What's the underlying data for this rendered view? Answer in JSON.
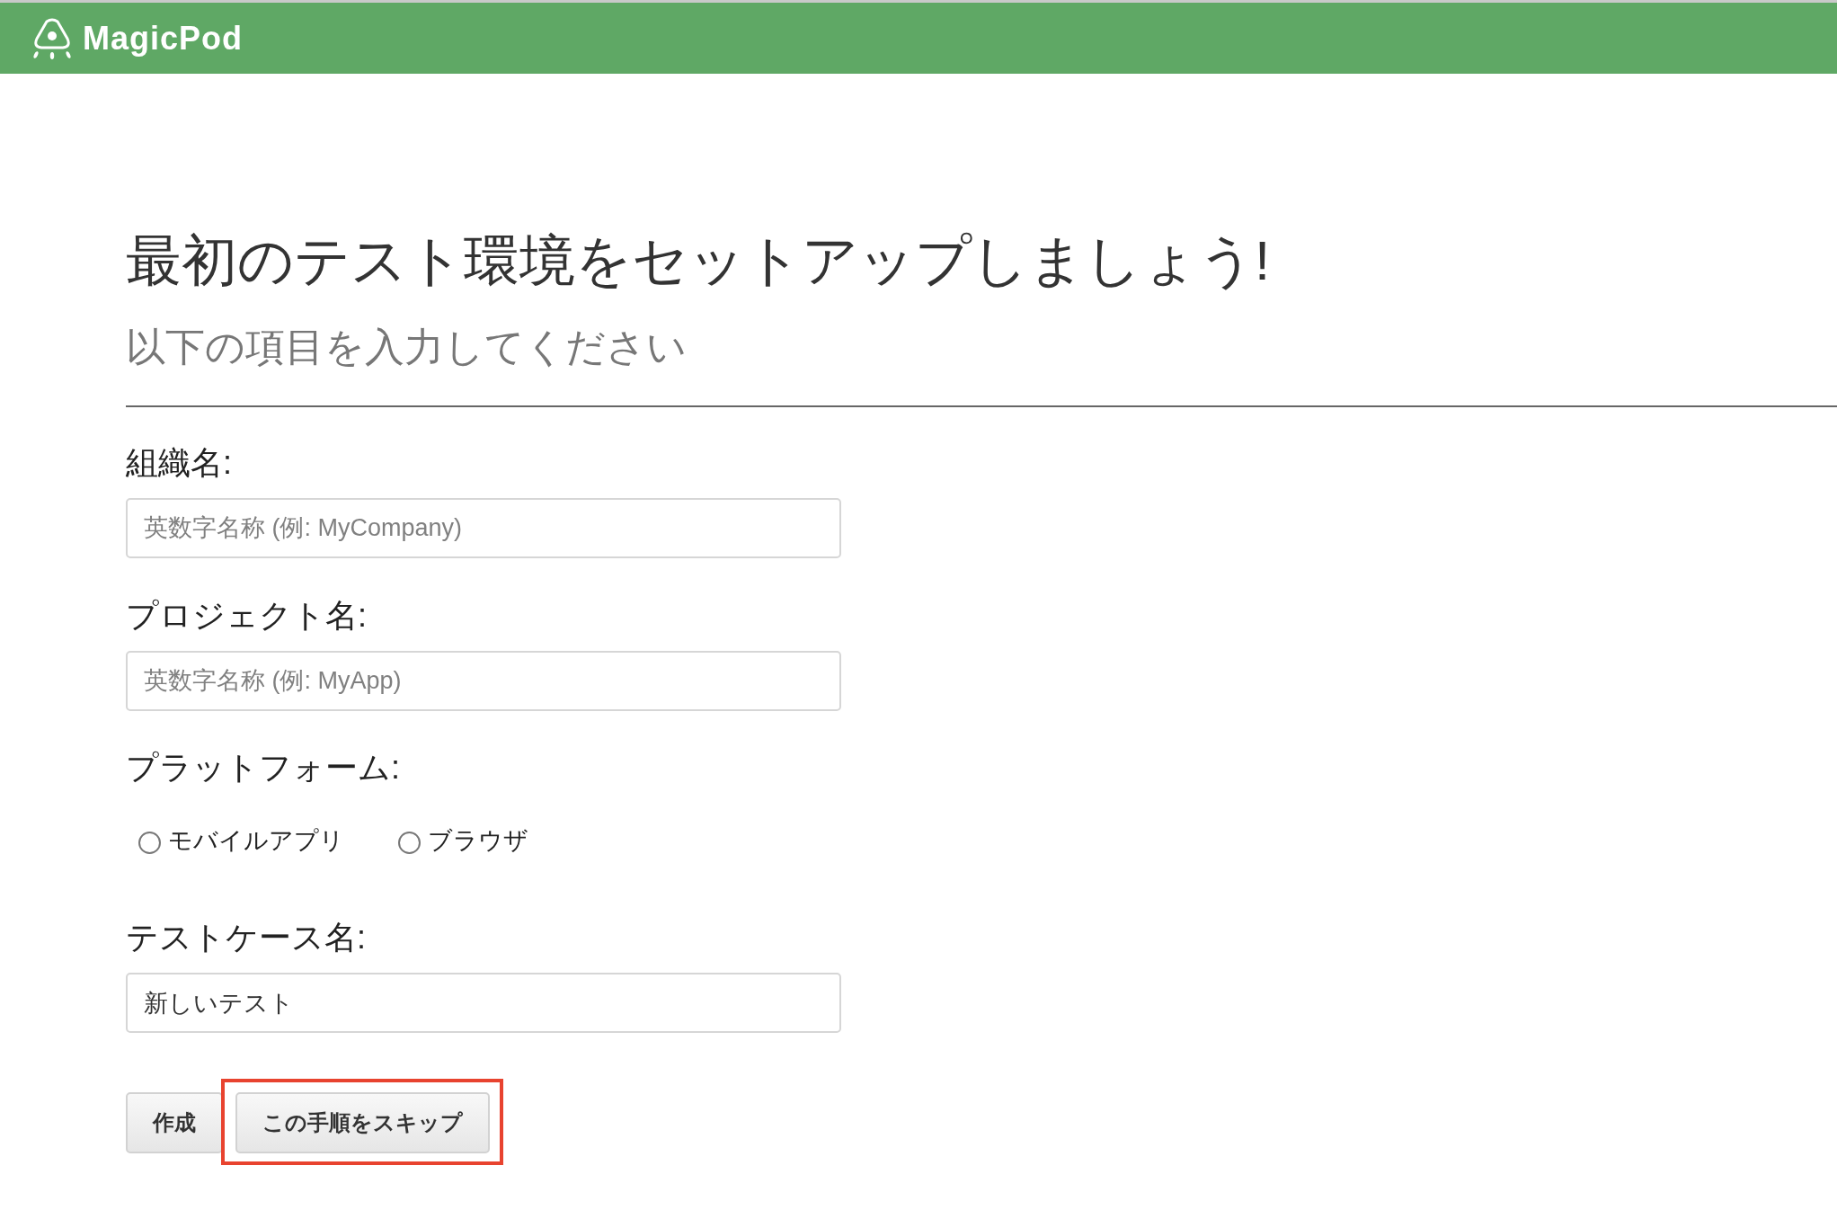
{
  "header": {
    "logo_text": "MagicPod"
  },
  "title": "最初のテスト環境をセットアップしましょう!",
  "subtitle": "以下の項目を入力してください",
  "form": {
    "fields": [
      {
        "kind": "text",
        "label": "組織名:",
        "placeholder": "英数字名称 (例: MyCompany)"
      },
      {
        "kind": "text",
        "label": "プロジェクト名:",
        "placeholder": "英数字名称 (例: MyApp)"
      },
      {
        "kind": "radio",
        "label": "プラットフォーム:",
        "options": [
          {
            "label": "モバイルアプリ",
            "selected": false
          },
          {
            "label": "ブラウザ",
            "selected": false
          }
        ]
      },
      {
        "kind": "text",
        "label": "テストケース名:",
        "value": "新しいテスト"
      }
    ],
    "buttons": [
      {
        "label": "作成",
        "highlighted": false
      },
      {
        "label": "この手順をスキップ",
        "highlighted": true
      }
    ]
  }
}
